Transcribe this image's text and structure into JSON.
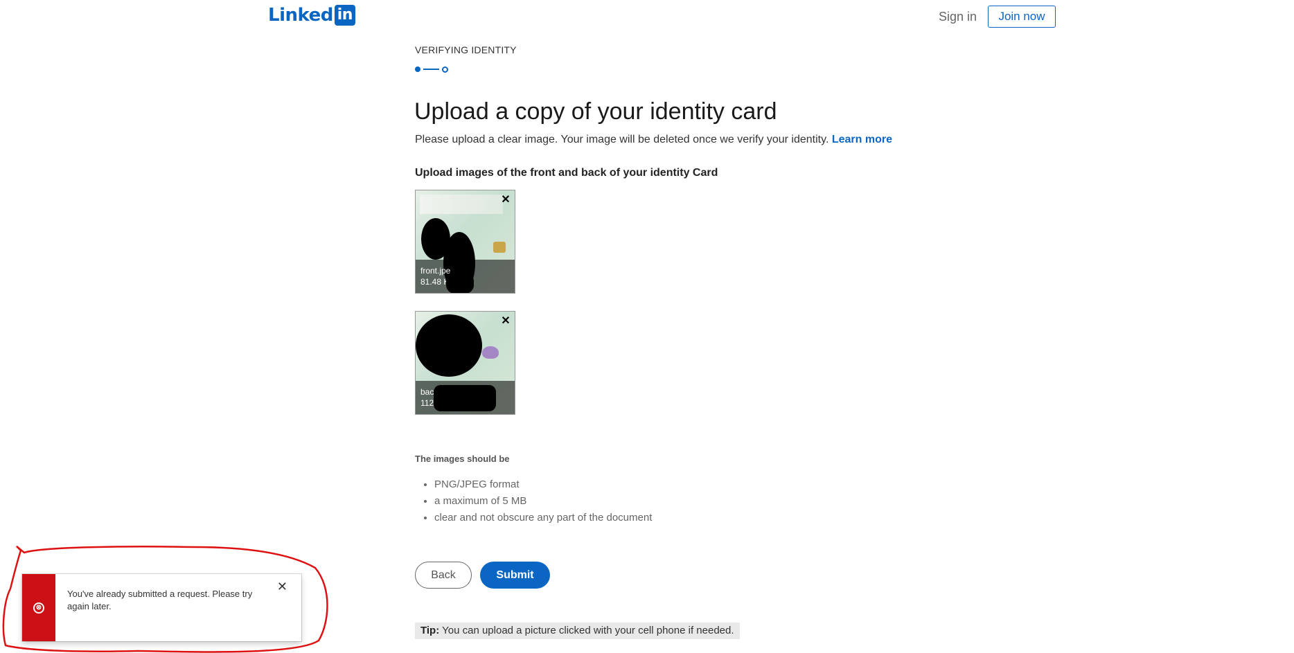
{
  "header": {
    "logo_text": "Linked",
    "logo_box": "in",
    "signin_label": "Sign in",
    "join_label": "Join now"
  },
  "step": {
    "label": "VERIFYING IDENTITY"
  },
  "main": {
    "title": "Upload a copy of your identity card",
    "description": "Please upload a clear image. Your image will be deleted once we verify your identity.",
    "learn_more": "Learn more",
    "upload_label": "Upload images of the front and back of your identity Card"
  },
  "uploads": [
    {
      "name": "front.jpe",
      "size": "81.48 K"
    },
    {
      "name": "bac",
      "size": "112"
    }
  ],
  "requirements": {
    "title": "The images should be",
    "items": [
      "PNG/JPEG format",
      "a maximum of 5 MB",
      "clear and not obscure any part of the document"
    ]
  },
  "buttons": {
    "back": "Back",
    "submit": "Submit"
  },
  "tip": {
    "label": "Tip:",
    "text": "You can upload a picture clicked with your cell phone if needed."
  },
  "toast": {
    "message": "You've already submitted a request. Please try again later.",
    "close": "✕",
    "icon": "⊗"
  },
  "colors": {
    "brand": "#0a66c2",
    "error": "#cc1016",
    "annotation": "#dd1111"
  }
}
